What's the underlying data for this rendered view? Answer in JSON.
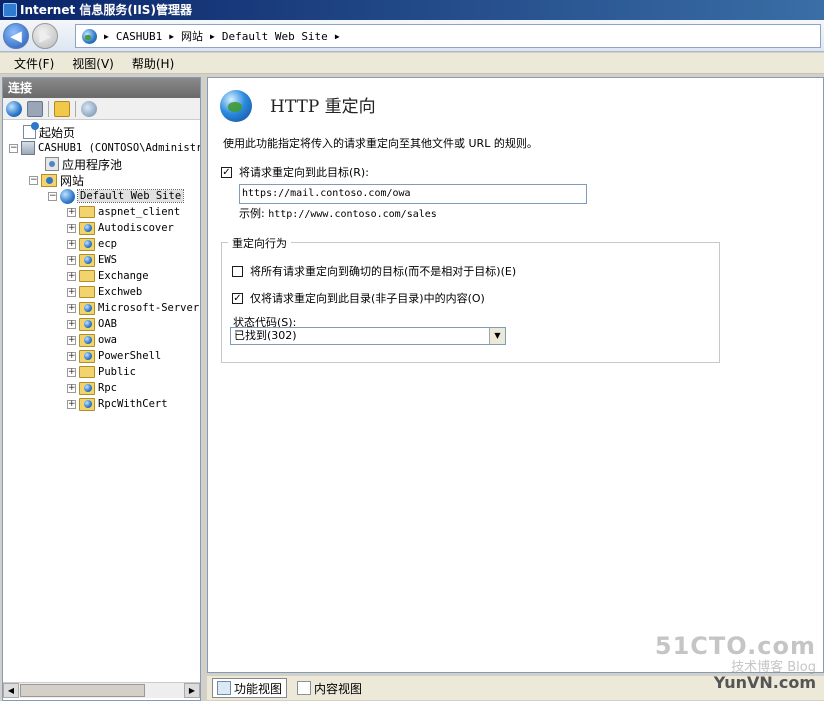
{
  "window": {
    "title": "Internet 信息服务(IIS)管理器"
  },
  "address": {
    "crumbs": [
      "CASHUB1",
      "网站",
      "Default Web Site"
    ]
  },
  "menu": [
    "文件(F)",
    "视图(V)",
    "帮助(H)"
  ],
  "connections": {
    "header": "连接",
    "tree": {
      "start_page": "起始页",
      "server": "CASHUB1 (CONTOSO\\Administr",
      "app_pools": "应用程序池",
      "sites": "网站",
      "default_site": "Default Web Site",
      "children": [
        "aspnet_client",
        "Autodiscover",
        "ecp",
        "EWS",
        "Exchange",
        "Exchweb",
        "Microsoft-Server",
        "OAB",
        "owa",
        "PowerShell",
        "Public",
        "Rpc",
        "RpcWithCert"
      ]
    }
  },
  "main": {
    "title": "HTTP 重定向",
    "description": "使用此功能指定将传入的请求重定向至其他文件或 URL 的规则。",
    "redirect_checkbox": {
      "label": "将请求重定向到此目标(R):",
      "checked": true
    },
    "target_url": "https://mail.contoso.com/owa",
    "example_label": "示例:",
    "example_value": "http://www.contoso.com/sales",
    "behavior": {
      "legend": "重定向行为",
      "exact_destination": {
        "label": "将所有请求重定向到确切的目标(而不是相对于目标)(E)",
        "checked": false
      },
      "only_this_dir": {
        "label": "仅将请求重定向到此目录(非子目录)中的内容(O)",
        "checked": true
      },
      "status_label": "状态代码(S):",
      "status_value": "已找到(302)"
    }
  },
  "bottom_tabs": {
    "features_view": "功能视图",
    "content_view": "内容视图"
  },
  "watermark": {
    "line1": "51CTO.com",
    "line2": "技术博客 Blog",
    "line3": "YunVN.com"
  }
}
